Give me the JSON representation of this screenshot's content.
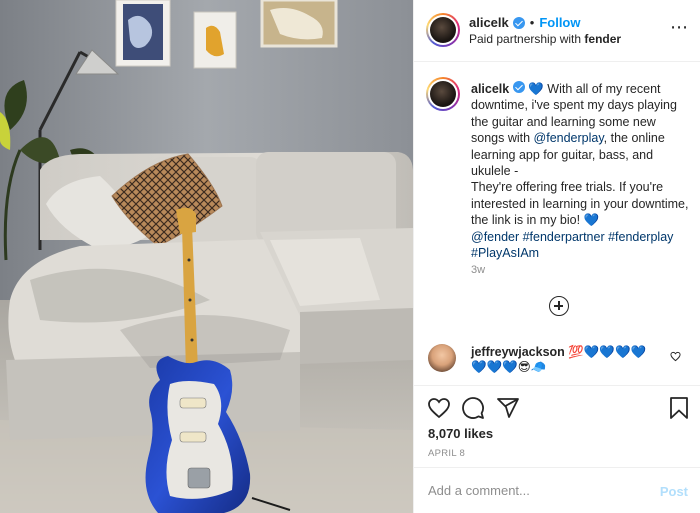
{
  "post": {
    "photo_alt": "",
    "author": {
      "username": "alicelk",
      "verified": true,
      "follow_label": "Follow",
      "separator": "•",
      "partnership_prefix": "Paid partnership with",
      "partner": "fender"
    },
    "more_icon": "more-options-icon",
    "caption": {
      "username": "alicelk",
      "lead_emoji": "💙",
      "part1": "With all of my recent downtime, i've spent my days playing the guitar and learning some new songs with ",
      "mention": "@fenderplay",
      "part2": ", the online learning app for guitar, bass, and ukulele -\nThey're offering free trials. If you're interested in learning in your downtime, the link is in my bio! 💙\n",
      "hashtags": "@fender #fenderpartner #fenderplay #PlayAsIAm",
      "time": "3w"
    },
    "load_more_icon": "load-more-comments-icon",
    "comment": {
      "username": "jeffreywjackson",
      "text": "💯💙💙💙💙💙💙💙😎🧢"
    },
    "actions": {
      "like_icon": "heart-icon",
      "comment_icon": "comment-icon",
      "share_icon": "share-icon",
      "save_icon": "bookmark-icon"
    },
    "likes": "8,070 likes",
    "date": "APRIL 8",
    "add_comment": {
      "placeholder": "Add a comment...",
      "post_label": "Post"
    }
  }
}
